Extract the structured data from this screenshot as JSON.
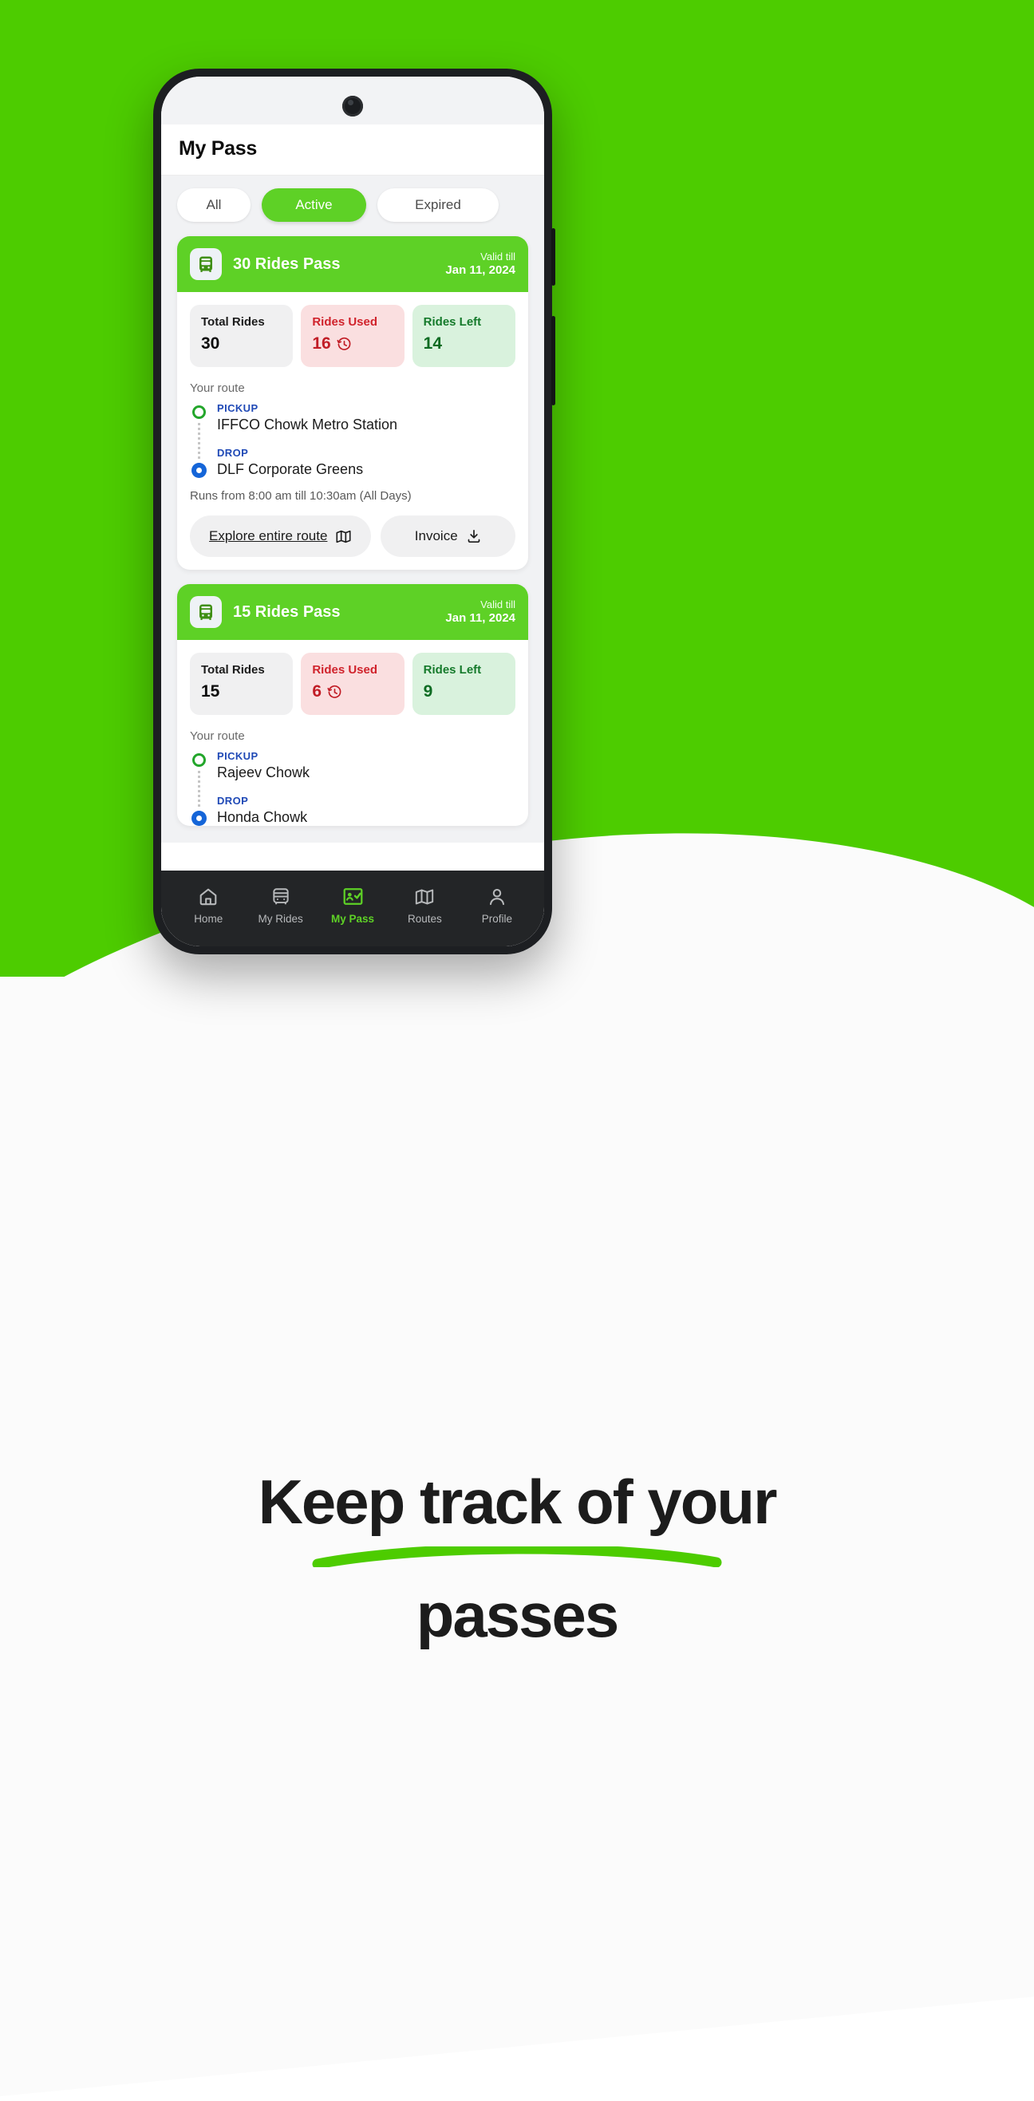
{
  "brand": {
    "green": "#5ed126",
    "bg_green": "#4dcc00",
    "blue": "#1f49b6",
    "red": "#c11d26"
  },
  "app": {
    "page_title": "My Pass",
    "tabs": [
      {
        "label": "All",
        "selected": false
      },
      {
        "label": "Active",
        "selected": true
      },
      {
        "label": "Expired",
        "selected": false
      }
    ]
  },
  "passes": [
    {
      "icon": "bus-icon",
      "title": "30 Rides Pass",
      "valid_label": "Valid till",
      "valid_date": "Jan 11, 2024",
      "stats": [
        {
          "label": "Total Rides",
          "value": "30",
          "icon": ""
        },
        {
          "label": "Rides Used",
          "value": "16",
          "icon": "history-clock-icon"
        },
        {
          "label": "Rides Left",
          "value": "14",
          "icon": ""
        }
      ],
      "route_heading": "Your route",
      "pickup_kind": "PICKUP",
      "pickup_name": "IFFCO Chowk Metro Station",
      "drop_kind": "DROP",
      "drop_name": "DLF Corporate Greens",
      "runs": "Runs from 8:00 am till 10:30am (All Days)",
      "explore_label": "Explore entire route",
      "explore_icon": "map-icon",
      "invoice_label": "Invoice",
      "invoice_icon": "download-icon"
    },
    {
      "icon": "bus-icon",
      "title": "15 Rides Pass",
      "valid_label": "Valid till",
      "valid_date": "Jan 11, 2024",
      "stats": [
        {
          "label": "Total Rides",
          "value": "15",
          "icon": ""
        },
        {
          "label": "Rides Used",
          "value": "6",
          "icon": "history-clock-icon"
        },
        {
          "label": "Rides Left",
          "value": "9",
          "icon": ""
        }
      ],
      "route_heading": "Your route",
      "pickup_kind": "PICKUP",
      "pickup_name": "Rajeev Chowk",
      "drop_kind": "DROP",
      "drop_name": "Honda Chowk",
      "runs": "",
      "explore_label": "",
      "explore_icon": "",
      "invoice_label": "",
      "invoice_icon": ""
    }
  ],
  "bottom_nav": [
    {
      "label": "Home",
      "icon": "home-icon",
      "active": false
    },
    {
      "label": "My Rides",
      "icon": "bus-icon",
      "active": false
    },
    {
      "label": "My Pass",
      "icon": "pass-id-icon",
      "active": true
    },
    {
      "label": "Routes",
      "icon": "map-icon",
      "active": false
    },
    {
      "label": "Profile",
      "icon": "person-icon",
      "active": false
    }
  ],
  "caption": {
    "line1": "Keep track of your",
    "line2": "passes"
  }
}
